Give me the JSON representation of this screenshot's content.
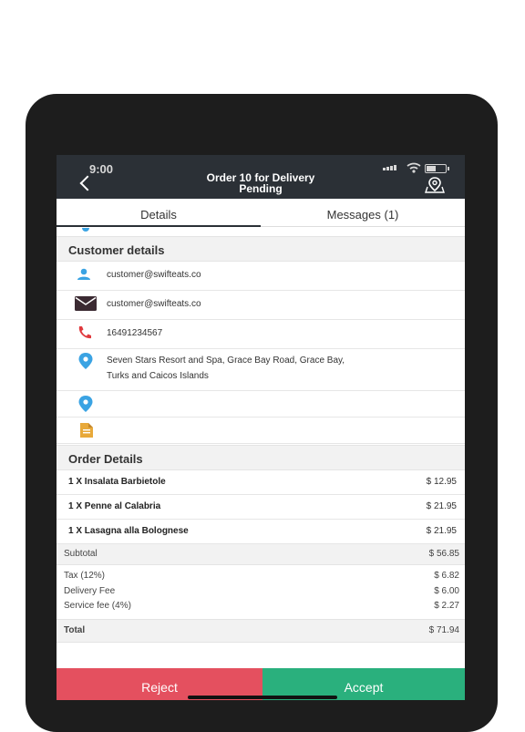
{
  "status": {
    "time": "9:00"
  },
  "header": {
    "title_line1": "Order 10 for Delivery",
    "title_line2": "Pending"
  },
  "tabs": [
    {
      "label": "Details"
    },
    {
      "label": "Messages (1)"
    }
  ],
  "customer": {
    "heading": "Customer details",
    "username": "customer@swifteats.co",
    "email": "customer@swifteats.co",
    "phone": "16491234567",
    "address_line1": "Seven Stars Resort and Spa, Grace Bay Road, Grace Bay,",
    "address_line2": "Turks and Caicos Islands"
  },
  "order": {
    "heading": "Order Details",
    "items": [
      {
        "name": "1 X Insalata Barbietole",
        "price": "$ 12.95"
      },
      {
        "name": "1 X Penne al Calabria",
        "price": "$ 21.95"
      },
      {
        "name": "1 X Lasagna alla Bolognese",
        "price": "$ 21.95"
      }
    ],
    "subtotal_label": "Subtotal",
    "subtotal": "$ 56.85",
    "tax_label": "Tax (12%)",
    "tax": "$ 6.82",
    "delivery_label": "Delivery Fee",
    "delivery": "$ 6.00",
    "service_label": "Service fee (4%)",
    "service": "$ 2.27",
    "total_label": "Total",
    "total": "$ 71.94"
  },
  "actions": {
    "reject": "Reject",
    "accept": "Accept"
  },
  "colors": {
    "reject": "#e4505f",
    "accept": "#2ab07d",
    "nav": "#2b3036",
    "icon_blue": "#3aa3e3",
    "icon_red": "#e03a3e"
  },
  "icons": [
    "back-icon",
    "map-pin-icon",
    "user-icon",
    "mail-icon",
    "phone-icon",
    "location-icon",
    "notes-icon"
  ]
}
